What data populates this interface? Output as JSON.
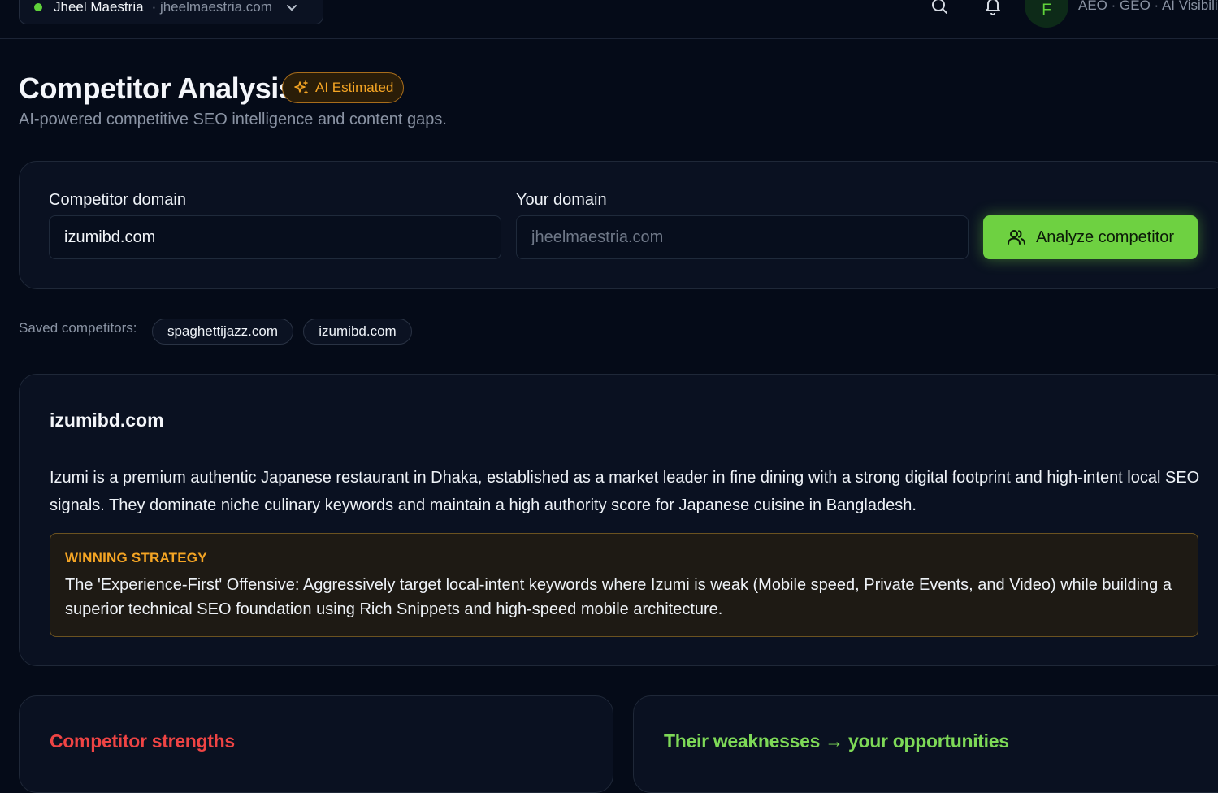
{
  "topbar": {
    "workspace_name": "Jheel Maestria",
    "workspace_domain": "· jheelmaestria.com",
    "avatar_initial": "F",
    "tagline": "AEO · GEO · AI Visibili",
    "status_color": "#5fd13a"
  },
  "header": {
    "title": "Competitor Analysis",
    "badge": "AI Estimated",
    "subtitle": "AI-powered competitive SEO intelligence and content gaps."
  },
  "form": {
    "competitor_label": "Competitor domain",
    "competitor_value": "izumibd.com",
    "your_label": "Your domain",
    "your_placeholder": "jheelmaestria.com",
    "analyze_label": "Analyze competitor",
    "accent_color": "#6ed141"
  },
  "saved": {
    "label": "Saved competitors:",
    "items": [
      "spaghettijazz.com",
      "izumibd.com"
    ]
  },
  "analysis": {
    "domain": "izumibd.com",
    "summary": "Izumi is a premium authentic Japanese restaurant in Dhaka, established as a market leader in fine dining with a strong digital footprint and high-intent local SEO signals. They dominate niche culinary keywords and maintain a high authority score for Japanese cuisine in Bangladesh.",
    "strategy_label": "WINNING STRATEGY",
    "strategy_text": "The 'Experience-First' Offensive: Aggressively target local-intent keywords where Izumi is weak (Mobile speed, Private Events, and Video) while building a superior technical SEO foundation using Rich Snippets and high-speed mobile architecture."
  },
  "sections": {
    "strengths_title": "Competitor strengths",
    "strengths_color": "#ef4444",
    "weaknesses_title": "Their weaknesses → your opportunities",
    "weaknesses_color": "#7ed957"
  }
}
